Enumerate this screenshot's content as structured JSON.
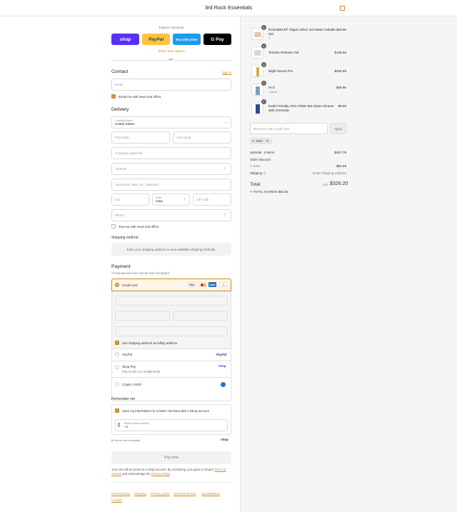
{
  "header": {
    "store_name": "3rd Rock Essentials"
  },
  "express": {
    "title": "Express checkout",
    "shop": "shop",
    "paypal": "PayPal",
    "amazon": "Buy with prime",
    "gpay": "G Pay",
    "more": "Show more options",
    "or": "OR"
  },
  "contact": {
    "title": "Contact",
    "sign_in": "Sign in",
    "email_placeholder": "Email",
    "news": "Email me with news and offers"
  },
  "delivery": {
    "title": "Delivery",
    "country_label": "Country/Region",
    "country_value": "United States",
    "first": "First name",
    "last": "Last name",
    "company": "Company (optional)",
    "address": "Address",
    "apt": "Apartment, suite, etc. (optional)",
    "city": "City",
    "state_label": "State",
    "state_value": "Iowa",
    "zip": "ZIP code",
    "phone": "Phone",
    "text_news": "Text me with news and offers"
  },
  "shipping": {
    "title": "Shipping method",
    "message": "Enter your shipping address to view available shipping methods."
  },
  "payment": {
    "title": "Payment",
    "subtitle": "All transactions are secure and encrypted.",
    "credit": "Credit card",
    "brands": [
      "VISA",
      "MC",
      "AMEX",
      "+5"
    ],
    "billing": "Use shipping address as billing address",
    "paypal": "PayPal",
    "paypal_logo": "PayPal",
    "shoppay": "Shop Pay",
    "shoppay_sub": "Pay in full or in installments",
    "shoppay_logo": "shop",
    "crypto": "Crypto: USDC"
  },
  "remember": {
    "title": "Remember me",
    "save": "Save my information for a faster checkout with a Shop account",
    "phone_label": "Mobile phone number",
    "phone_value": "+1",
    "secure": "Secure and encrypted",
    "shop_logo": "shop"
  },
  "paynow": {
    "label": "Pay now",
    "notice_1": "Your info will be saved to a Shop account. By continuing, you agree to Shop's",
    "terms": "Terms of Service",
    "notice_2": "and acknowledge the",
    "privacy": "Privacy Policy"
  },
  "footer": {
    "links": [
      "Refund policy",
      "Shipping",
      "Privacy policy",
      "Terms of service",
      "Cancellations",
      "Contact"
    ]
  },
  "cart": {
    "items": [
      {
        "name": "RASHBlock® 75ppm Silver Gel Water Soluble 3oz",
        "sub": "1",
        "price": "$19.95",
        "qty": "1"
      },
      {
        "name": "Tension Release Gel",
        "sub": "",
        "price": "$145.95",
        "qty": "1"
      },
      {
        "name": "Night Serum Pro",
        "sub": "",
        "price": "$204.95",
        "qty": "1"
      },
      {
        "name": "Hi-Z",
        "sub": "1 piece",
        "price": "$26.95",
        "qty": "1"
      },
      {
        "name": "Earth Friendly VOC FREE Bio-Glass Cleaner with Ammonia",
        "sub": "",
        "price": "$9.95",
        "qty": "1"
      }
    ],
    "discount_placeholder": "Discount code or gift card",
    "apply": "Apply",
    "code": "KKO",
    "subtotal_label": "Subtotal · 5 items",
    "subtotal": "$407.75",
    "order_discount": "Order discount",
    "discount_code": "KKO",
    "discount_amount": "- $81.55",
    "shipping_label": "Shipping",
    "shipping_value": "Enter shipping address",
    "total_label": "Total",
    "currency": "USD",
    "total": "$326.20",
    "savings_label": "TOTAL SAVINGS",
    "savings": "$81.55"
  }
}
